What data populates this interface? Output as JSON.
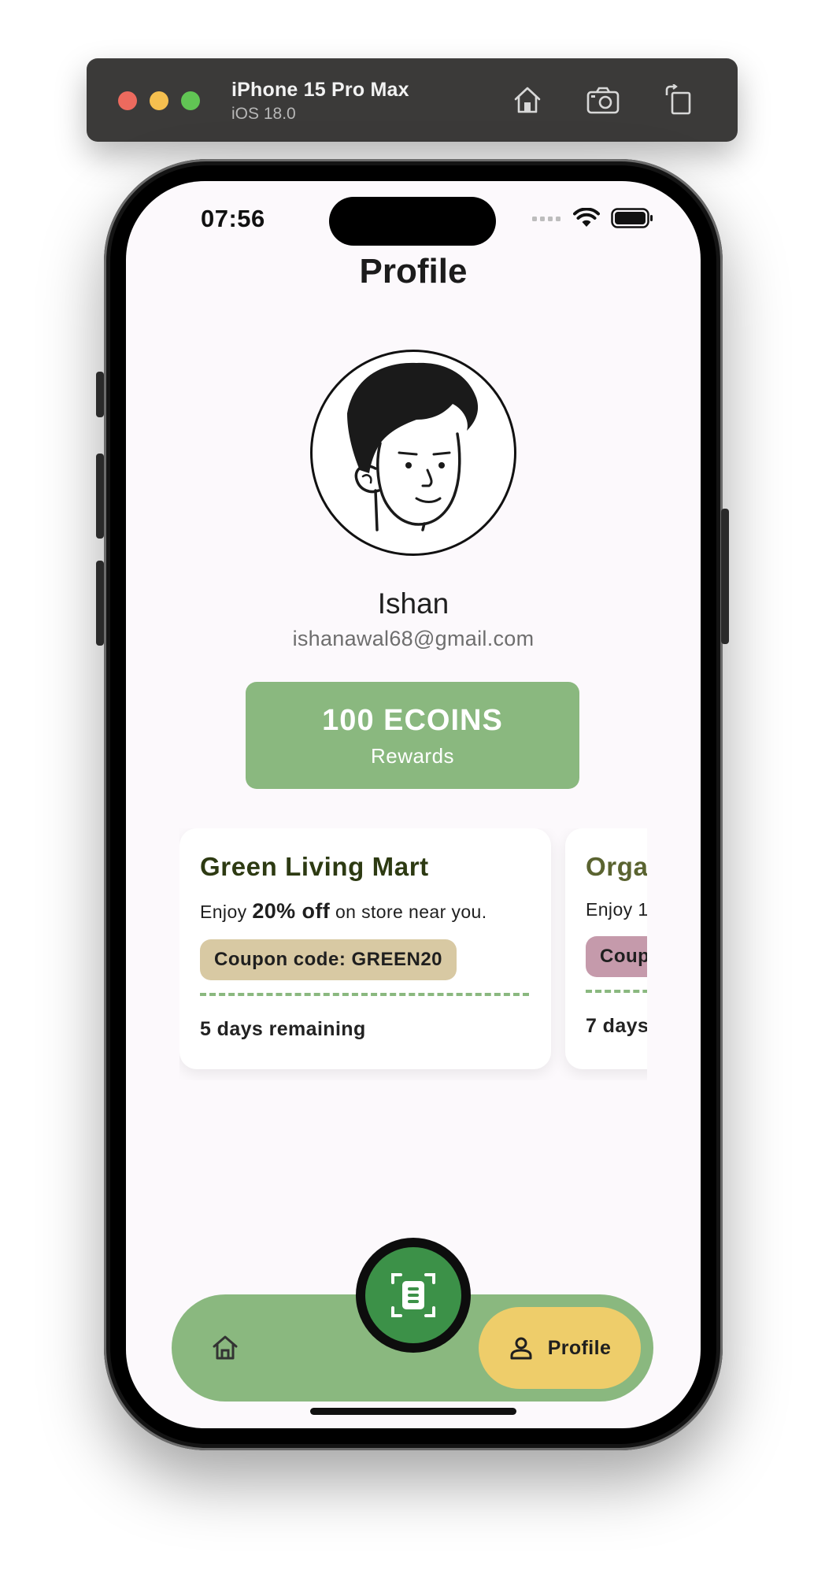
{
  "simulator": {
    "device_name": "iPhone 15 Pro Max",
    "os_version": "iOS 18.0",
    "toolbar_icons": [
      "home-icon",
      "screenshot-icon",
      "rotate-icon"
    ]
  },
  "status_bar": {
    "time": "07:56",
    "icons": [
      "signal-icon",
      "wifi-icon",
      "battery-icon"
    ]
  },
  "page": {
    "title": "Profile"
  },
  "user": {
    "name": "Ishan",
    "email": "ishanawal68@gmail.com"
  },
  "rewards": {
    "amount": "100 ECOINS",
    "label": "Rewards"
  },
  "coupons": [
    {
      "store": "Green Living Mart",
      "desc_prefix": "Enjoy ",
      "discount": "20% off",
      "desc_suffix": " on store near you.",
      "code": "Coupon code: GREEN20",
      "remaining": "5 days remaining",
      "store_color": "#2d3a12",
      "code_bg": "#d8c9a3"
    },
    {
      "store": "Orga",
      "desc_prefix": "Enjoy 1",
      "discount": "",
      "desc_suffix": "",
      "code": "Coup",
      "remaining": "7 days",
      "store_color": "#5a6330",
      "code_bg": "#c59aab"
    }
  ],
  "navigation": {
    "home_icon": "home-icon",
    "scan_icon": "scan-icon",
    "profile_label": "Profile",
    "profile_icon": "person-icon"
  },
  "colors": {
    "accent_green": "#8ab87f",
    "fab_green": "#3c9148",
    "active_tab": "#eecd6a",
    "screen_bg": "#fcf9fc"
  }
}
